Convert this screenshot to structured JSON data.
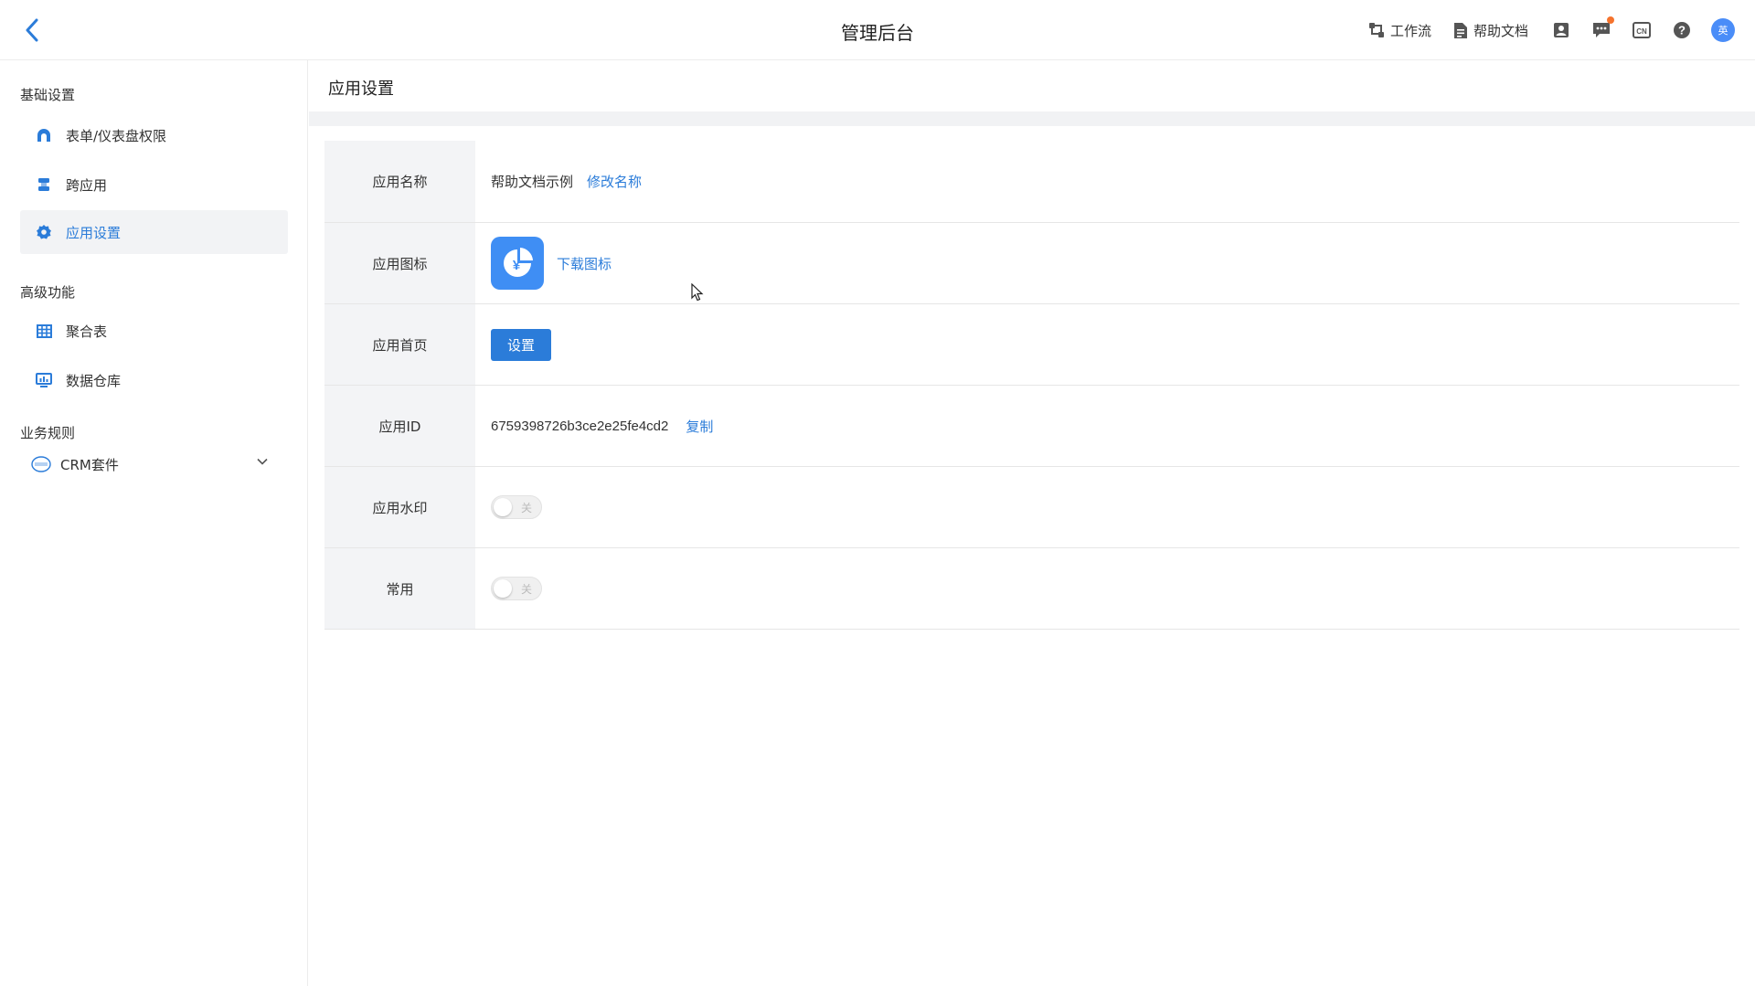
{
  "header": {
    "title": "管理后台",
    "workflow_label": "工作流",
    "help_docs_label": "帮助文档",
    "lang_icon_text": "CN",
    "help_icon_text": "?",
    "avatar_text": "英"
  },
  "sidebar": {
    "groups": [
      {
        "title": "基础设置",
        "items": [
          {
            "label": "表单/仪表盘权限",
            "icon": "permission-icon"
          },
          {
            "label": "跨应用",
            "icon": "cross-app-icon"
          },
          {
            "label": "应用设置",
            "icon": "gear-icon",
            "active": true
          }
        ]
      },
      {
        "title": "高级功能",
        "items": [
          {
            "label": "聚合表",
            "icon": "table-icon"
          },
          {
            "label": "数据仓库",
            "icon": "data-warehouse-icon"
          }
        ]
      },
      {
        "title": "业务规则",
        "items": [
          {
            "label": "CRM套件",
            "icon": "crm-icon",
            "expandable": true
          }
        ]
      }
    ]
  },
  "main": {
    "title": "应用设置",
    "rows": {
      "name": {
        "label": "应用名称",
        "value": "帮助文档示例",
        "action": "修改名称"
      },
      "icon": {
        "label": "应用图标",
        "action": "下载图标",
        "glyph": "¥"
      },
      "home": {
        "label": "应用首页",
        "button": "设置"
      },
      "id": {
        "label": "应用ID",
        "value": "6759398726b3ce2e25fe4cd2",
        "action": "复制"
      },
      "watermark": {
        "label": "应用水印",
        "toggle_text": "关",
        "enabled": false
      },
      "favorite": {
        "label": "常用",
        "toggle_text": "关",
        "enabled": false
      }
    }
  },
  "colors": {
    "accent": "#2b7cd9",
    "app_icon_bg": "#3f8ef4",
    "notify_dot": "#f5732d"
  }
}
